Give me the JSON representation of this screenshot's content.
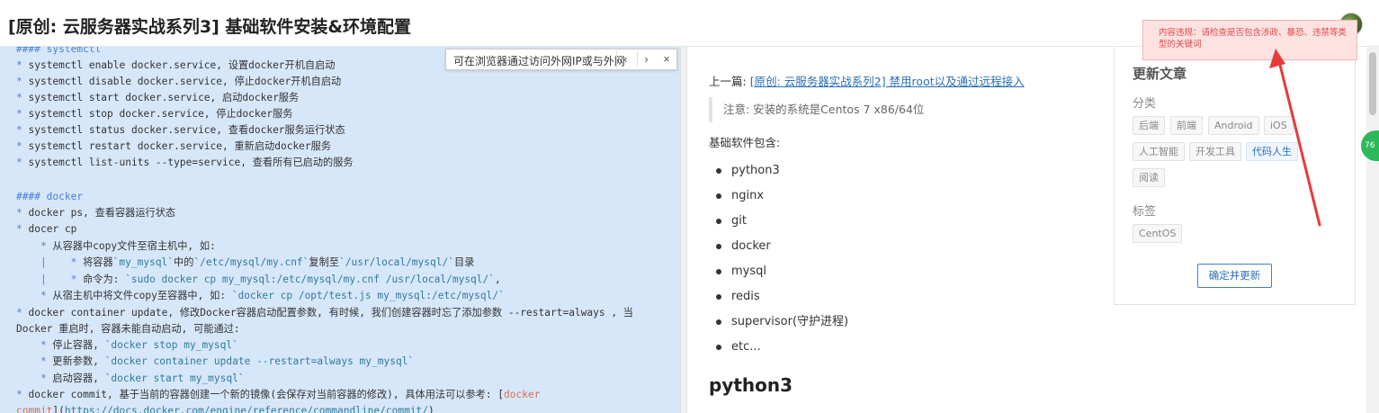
{
  "header": {
    "title": "[原创: 云服务器实战系列3] 基础软件安装&环境配置"
  },
  "find_bar": {
    "text": "可在浏览器通过访问外网IP或与外网",
    "prev_icon": "chevron-left-icon",
    "next_icon": "chevron-right-icon",
    "close_icon": "close-icon",
    "prev_glyph": "‹",
    "next_glyph": "›",
    "close_glyph": "×"
  },
  "editor_lines": [
    [
      {
        "t": "#### systemctl",
        "c": "md-h"
      }
    ],
    [
      {
        "t": "* ",
        "c": "md-b"
      },
      {
        "t": "systemctl enable docker.service, 设置docker开机自启动",
        "c": ""
      }
    ],
    [
      {
        "t": "* ",
        "c": "md-b"
      },
      {
        "t": "systemctl disable docker.service, 停止docker开机自启动",
        "c": ""
      }
    ],
    [
      {
        "t": "* ",
        "c": "md-b"
      },
      {
        "t": "systemctl start docker.service, 启动docker服务",
        "c": ""
      }
    ],
    [
      {
        "t": "* ",
        "c": "md-b"
      },
      {
        "t": "systemctl stop docker.service, 停止docker服务",
        "c": ""
      }
    ],
    [
      {
        "t": "* ",
        "c": "md-b"
      },
      {
        "t": "systemctl status docker.service, 查看docker服务运行状态",
        "c": ""
      }
    ],
    [
      {
        "t": "* ",
        "c": "md-b"
      },
      {
        "t": "systemctl restart docker.service, 重新启动docker服务",
        "c": ""
      }
    ],
    [
      {
        "t": "* ",
        "c": "md-b"
      },
      {
        "t": "systemctl list-units --type=service, 查看所有已启动的服务",
        "c": ""
      }
    ],
    [
      {
        "t": "",
        "c": ""
      }
    ],
    [
      {
        "t": "#### docker",
        "c": "md-h"
      }
    ],
    [
      {
        "t": "* ",
        "c": "md-b"
      },
      {
        "t": "docker ps, 查看容器运行状态",
        "c": ""
      }
    ],
    [
      {
        "t": "* ",
        "c": "md-b"
      },
      {
        "t": "docer cp",
        "c": ""
      }
    ],
    [
      {
        "t": "    * ",
        "c": "md-b"
      },
      {
        "t": "从容器中copy文件至宿主机中, 如:",
        "c": ""
      }
    ],
    [
      {
        "t": "    |    * ",
        "c": "md-b"
      },
      {
        "t": "将容器",
        "c": ""
      },
      {
        "t": "`my_mysql`",
        "c": "md-c"
      },
      {
        "t": "中的",
        "c": ""
      },
      {
        "t": "`/etc/mysql/my.cnf`",
        "c": "md-c"
      },
      {
        "t": "复制至",
        "c": ""
      },
      {
        "t": "`/usr/local/mysql/`",
        "c": "md-c"
      },
      {
        "t": "目录",
        "c": ""
      }
    ],
    [
      {
        "t": "    |    * ",
        "c": "md-b"
      },
      {
        "t": "命令为: ",
        "c": ""
      },
      {
        "t": "`sudo docker cp my_mysql:/etc/mysql/my.cnf /usr/local/mysql/`",
        "c": "md-c"
      },
      {
        "t": ",",
        "c": ""
      }
    ],
    [
      {
        "t": "    * ",
        "c": "md-b"
      },
      {
        "t": "从宿主机中将文件copy至容器中, 如: ",
        "c": ""
      },
      {
        "t": "`docker cp /opt/test.js my_mysql:/etc/mysql/`",
        "c": "md-c"
      }
    ],
    [
      {
        "t": "* ",
        "c": "md-b"
      },
      {
        "t": "docker container update, 修改Docker容器启动配置参数, 有时候, 我们创建容器时忘了添加参数 --restart=always , 当",
        "c": ""
      }
    ],
    [
      {
        "t": "Docker 重启时, 容器未能自动启动, 可能通过:",
        "c": ""
      }
    ],
    [
      {
        "t": "    * ",
        "c": "md-b"
      },
      {
        "t": "停止容器, ",
        "c": ""
      },
      {
        "t": "`docker stop my_mysql`",
        "c": "md-c"
      }
    ],
    [
      {
        "t": "    * ",
        "c": "md-b"
      },
      {
        "t": "更新参数, ",
        "c": ""
      },
      {
        "t": "`docker container update --restart=always my_mysql`",
        "c": "md-c"
      }
    ],
    [
      {
        "t": "    * ",
        "c": "md-b"
      },
      {
        "t": "启动容器, ",
        "c": ""
      },
      {
        "t": "`docker start my_mysql`",
        "c": "md-c"
      }
    ],
    [
      {
        "t": "* ",
        "c": "md-b"
      },
      {
        "t": "docker commit, 基于当前的容器创建一个新的镜像(会保存对当前容器的修改), 具体用法可以参考: [",
        "c": ""
      },
      {
        "t": "docker",
        "c": "md-l"
      }
    ],
    [
      {
        "t": "commit",
        "c": "md-l"
      },
      {
        "t": "](",
        "c": ""
      },
      {
        "t": "https://docs.docker.com/engine/reference/commandline/commit/",
        "c": "md-u"
      },
      {
        "t": ")",
        "c": ""
      }
    ]
  ],
  "preview": {
    "prev_label": "上一篇: ",
    "prev_link": "[原创: 云服务器实战系列2] 禁用root以及通过远程接入",
    "quote": "注意: 安装的系统是Centos 7 x86/64位",
    "intro": "基础软件包含:",
    "bullets": [
      "python3",
      "nginx",
      "git",
      "docker",
      "mysql",
      "redis",
      "supervisor(守护进程)",
      "etc..."
    ],
    "heading": "python3"
  },
  "sidebar": {
    "title": "更新文章",
    "category_label": "分类",
    "categories": [
      "后端",
      "前端",
      "Android",
      "iOS",
      "人工智能",
      "开发工具",
      "代码人生",
      "阅读"
    ],
    "active_category": "代码人生",
    "tags_label": "标签",
    "tags": [
      "CentOS"
    ],
    "confirm_button": "确定并更新"
  },
  "toast": {
    "message": "内容违规：请检查是否包含涉政、暴恐、违禁等类型的关键词"
  },
  "floating_badge": {
    "text": "76"
  },
  "colors": {
    "editor_bg": "#d7e7fa",
    "link": "#2e6fb5",
    "toast_bg": "#fde2e2",
    "toast_text": "#e04848",
    "annotation_arrow": "#e83a3a"
  }
}
